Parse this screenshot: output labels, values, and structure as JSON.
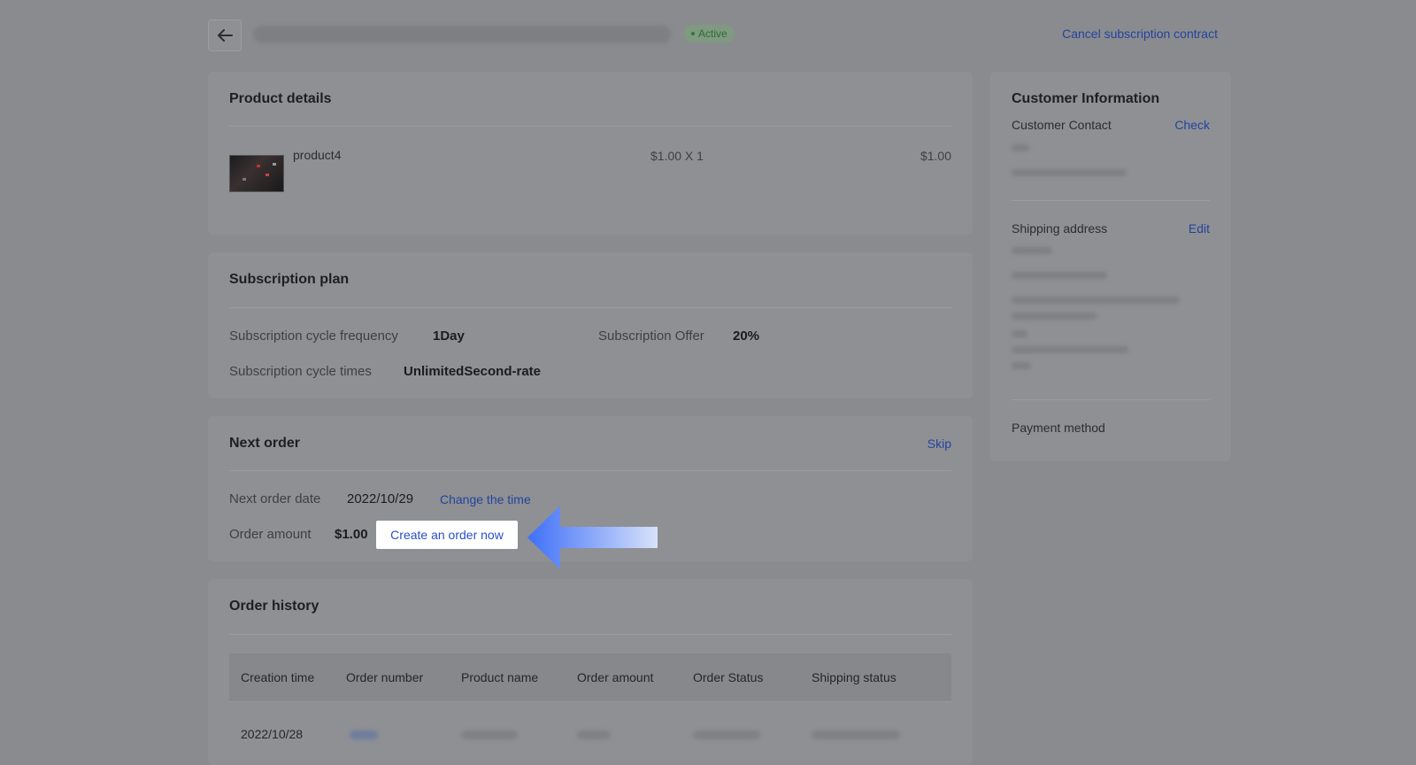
{
  "header": {
    "status": "Active",
    "cancel_link": "Cancel subscription contract"
  },
  "product_details": {
    "title": "Product details",
    "product_name": "product4",
    "price_qty": "$1.00 X 1",
    "total": "$1.00"
  },
  "subscription_plan": {
    "title": "Subscription plan",
    "frequency_label": "Subscription cycle frequency",
    "frequency_value": "1Day",
    "offer_label": "Subscription Offer",
    "offer_value": "20%",
    "times_label": "Subscription cycle times",
    "times_value": "UnlimitedSecond-rate"
  },
  "next_order": {
    "title": "Next order",
    "skip": "Skip",
    "date_label": "Next order date",
    "date_value": "2022/10/29",
    "change_time": "Change the time",
    "amount_label": "Order amount",
    "amount_value": "$1.00",
    "create_order": "Create an order now"
  },
  "order_history": {
    "title": "Order history",
    "columns": [
      "Creation time",
      "Order number",
      "Product name",
      "Order amount",
      "Order Status",
      "Shipping status"
    ],
    "rows": [
      {
        "creation_time": "2022/10/28"
      }
    ]
  },
  "customer": {
    "title": "Customer Information",
    "contact_label": "Customer Contact",
    "check": "Check",
    "shipping_label": "Shipping address",
    "edit": "Edit",
    "payment_label": "Payment method"
  },
  "colors": {
    "overlay_bg": "#898b8f",
    "link_blue": "#23449d",
    "button_text": "#2a4fc7",
    "arrow_blue": "#3e6ff7"
  },
  "icons": [
    "back-arrow-icon",
    "arrow-pointer-icon"
  ]
}
